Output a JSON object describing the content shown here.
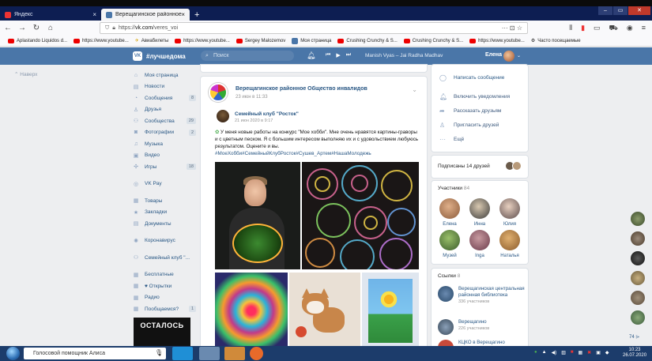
{
  "browser": {
    "tabs": [
      {
        "label": "Яндекс"
      },
      {
        "label": "Верещагинское районное Об"
      }
    ],
    "url_prefix": "https://",
    "url_host": "vk.com",
    "url_path": "/veres_voi",
    "url_menu": "··· ⊡ ☆",
    "new_tab": "+",
    "close": "×"
  },
  "bookmarks": [
    {
      "label": "Aplastando Liquidos d..."
    },
    {
      "label": "https://www.youtube..."
    },
    {
      "label": "Авиабилеты"
    },
    {
      "label": "https://www.youtube..."
    },
    {
      "label": "Sergey Malozemov"
    },
    {
      "label": "Моя страница"
    },
    {
      "label": "Crushing Crunchy & S..."
    },
    {
      "label": "Crushing Crunchy & S..."
    },
    {
      "label": "https://www.youtube..."
    },
    {
      "label": "Часто посещаемые"
    }
  ],
  "vk_header": {
    "logo": "VK",
    "hashtag": "#лучшедома",
    "search_placeholder": "Поиск",
    "track": "Manish Vyas – Jai Radha Madhav",
    "user": "Елена"
  },
  "back_to_top": "Наверх",
  "sidebar": {
    "items": [
      {
        "label": "Моя страница",
        "count": ""
      },
      {
        "label": "Новости",
        "count": ""
      },
      {
        "label": "Сообщения",
        "count": "8"
      },
      {
        "label": "Друзья",
        "count": ""
      },
      {
        "label": "Сообщества",
        "count": "29"
      },
      {
        "label": "Фотографии",
        "count": "2"
      },
      {
        "label": "Музыка",
        "count": ""
      },
      {
        "label": "Видео",
        "count": ""
      },
      {
        "label": "Игры",
        "count": "18"
      }
    ],
    "vkpay": "VK Pay",
    "group2": [
      {
        "label": "Товары"
      },
      {
        "label": "Закладки"
      },
      {
        "label": "Документы"
      }
    ],
    "corona": "Коронавирус",
    "family": "Семейный клуб \"...",
    "group3": [
      {
        "label": "Бесплатные",
        "count": ""
      },
      {
        "label": "♥ Открытки",
        "count": ""
      },
      {
        "label": "Радио",
        "count": ""
      },
      {
        "label": "Пообщаемся?",
        "count": "1"
      }
    ],
    "promo": "ОСТАЛОСЬ"
  },
  "post": {
    "group_name": "Верещагинское районное Общество инвалидов",
    "group_date": "23 июн в 11:33",
    "club_name": "Семейный клуб \"Росток\"",
    "club_date": "21 июн 2020 в 9:17",
    "text": "У меня новые работы на конкурс \"Мое хобби\". Мне очень нравятся картины-граворы и с цветным песком. Я с большим интересом выполняю их и с удовольствием любуюсь результатом. Оцените и вы.",
    "hashtags": "#МоеХобби#СемейныйКлубРосток#Сушев_Артем#НашаМолодежь"
  },
  "right": {
    "actions": [
      {
        "label": "Написать сообщение"
      },
      {
        "label": "Включить уведомления"
      },
      {
        "label": "Рассказать друзьям"
      },
      {
        "label": "Пригласить друзей"
      },
      {
        "label": "Ещё"
      }
    ],
    "subs_label": "Подписаны 14 друзей",
    "members_title": "Участники",
    "members_count": "84",
    "members": [
      {
        "name": "Елена"
      },
      {
        "name": "Инна"
      },
      {
        "name": "Юлия"
      },
      {
        "name": "Музей"
      },
      {
        "name": "Inga"
      },
      {
        "name": "Наталья"
      }
    ],
    "links_title": "Ссылки",
    "links_count": "8",
    "links": [
      {
        "title": "Верещагинская центральная районная библиотека",
        "sub": "336 участников"
      },
      {
        "title": "Верещагино",
        "sub": "226 участников"
      },
      {
        "title": "КЦКО в Верещагино",
        "sub": ""
      }
    ],
    "float_count": "74 ⩥"
  },
  "taskbar": {
    "assistant": "Голосовой помощник Алиса",
    "time": "10:23",
    "date": "26.07.2020"
  },
  "colors": {
    "vk_blue": "#4a76a8",
    "link": "#2a5885",
    "bg": "#edeef0"
  }
}
